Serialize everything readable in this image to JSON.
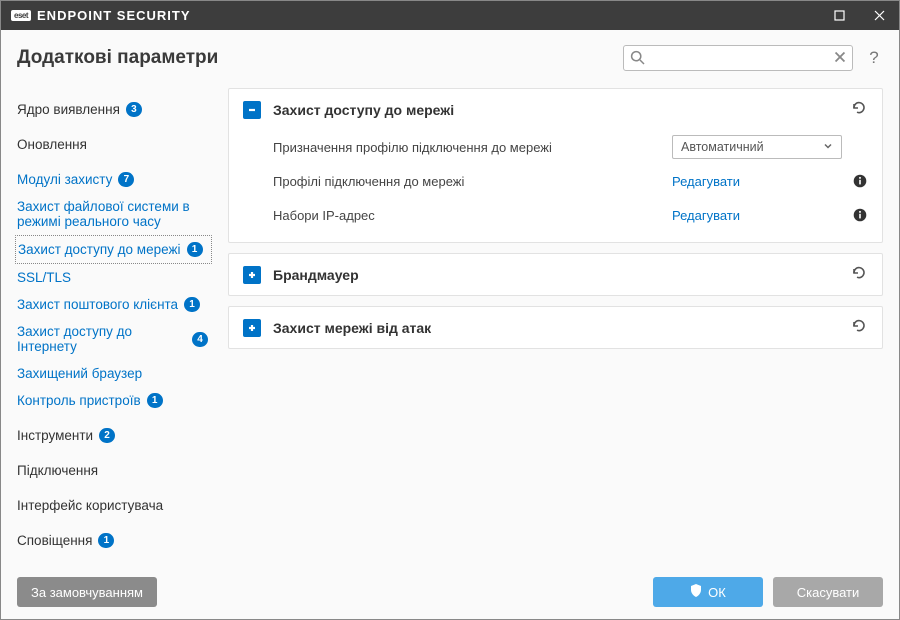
{
  "titlebar": {
    "brand": "eset",
    "product": "ENDPOINT SECURITY"
  },
  "header": {
    "title": "Додаткові параметри",
    "searchPlaceholder": ""
  },
  "sidebar": {
    "items": [
      {
        "label": "Ядро виявлення",
        "badge": "3",
        "link": false,
        "top": true
      },
      {
        "label": "Оновлення",
        "badge": null,
        "link": false,
        "top": true
      },
      {
        "label": "Модулі захисту",
        "badge": "7",
        "link": true,
        "top": true
      },
      {
        "label": "Захист файлової системи в режимі реального часу",
        "badge": null,
        "link": true,
        "top": false
      },
      {
        "label": "Захист доступу до мережі",
        "badge": "1",
        "link": true,
        "top": false,
        "active": true
      },
      {
        "label": "SSL/TLS",
        "badge": null,
        "link": true,
        "top": false
      },
      {
        "label": "Захист поштового клієнта",
        "badge": "1",
        "link": true,
        "top": false
      },
      {
        "label": "Захист доступу до Інтернету",
        "badge": "4",
        "link": true,
        "top": false
      },
      {
        "label": "Захищений браузер",
        "badge": null,
        "link": true,
        "top": false
      },
      {
        "label": "Контроль пристроїв",
        "badge": "1",
        "link": true,
        "top": false
      },
      {
        "label": "Інструменти",
        "badge": "2",
        "link": false,
        "top": true
      },
      {
        "label": "Підключення",
        "badge": null,
        "link": false,
        "top": true
      },
      {
        "label": "Інтерфейс користувача",
        "badge": null,
        "link": false,
        "top": true
      },
      {
        "label": "Сповіщення",
        "badge": "1",
        "link": false,
        "top": true
      }
    ]
  },
  "panels": [
    {
      "title": "Захист доступу до мережі",
      "expanded": true,
      "rows": [
        {
          "label": "Призначення профілю підключення до мережі",
          "control": "select",
          "value": "Автоматичний",
          "info": false
        },
        {
          "label": "Профілі підключення до мережі",
          "control": "link",
          "value": "Редагувати",
          "info": true
        },
        {
          "label": "Набори IP-адрес",
          "control": "link",
          "value": "Редагувати",
          "info": true
        }
      ]
    },
    {
      "title": "Брандмауер",
      "expanded": false
    },
    {
      "title": "Захист мережі від атак",
      "expanded": false
    }
  ],
  "footer": {
    "default": "За замовчуванням",
    "ok": "ОК",
    "cancel": "Скасувати"
  }
}
